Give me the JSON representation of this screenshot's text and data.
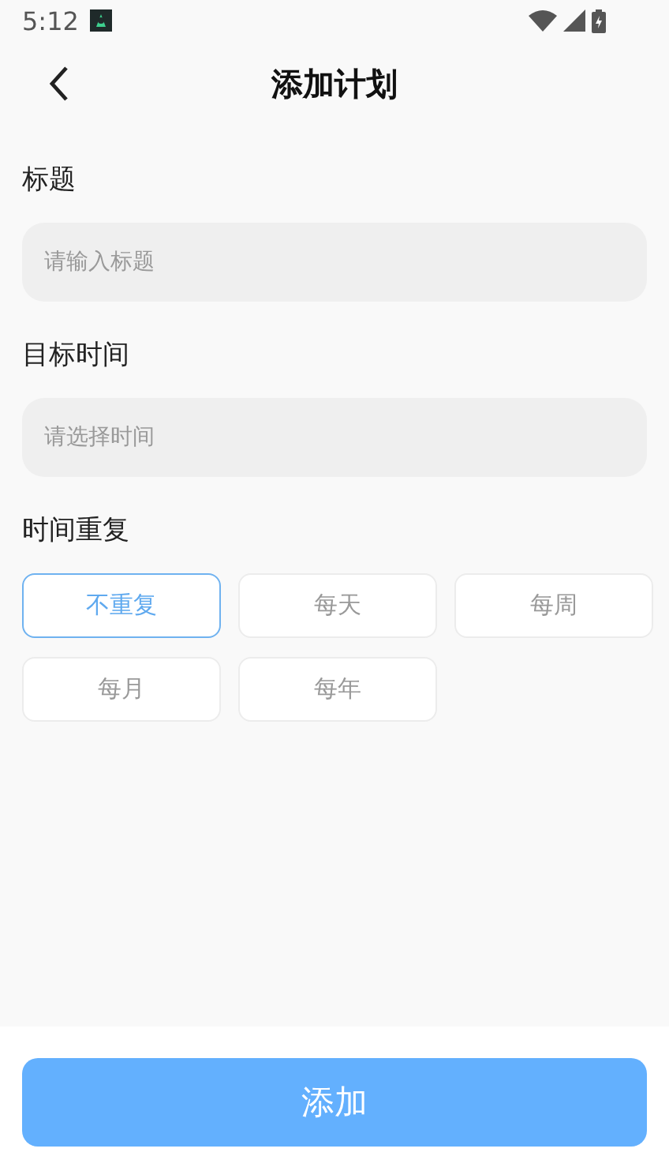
{
  "status_bar": {
    "time": "5:12"
  },
  "header": {
    "title": "添加计划"
  },
  "fields": [
    {
      "label": "标题",
      "placeholder": "请输入标题"
    },
    {
      "label": "目标时间",
      "placeholder": "请选择时间"
    }
  ],
  "repeat": {
    "label": "时间重复",
    "options": [
      {
        "label": "不重复",
        "selected": true
      },
      {
        "label": "每天",
        "selected": false
      },
      {
        "label": "每周",
        "selected": false
      },
      {
        "label": "每月",
        "selected": false
      },
      {
        "label": "每年",
        "selected": false
      }
    ]
  },
  "submit_button": {
    "label": "添加"
  }
}
